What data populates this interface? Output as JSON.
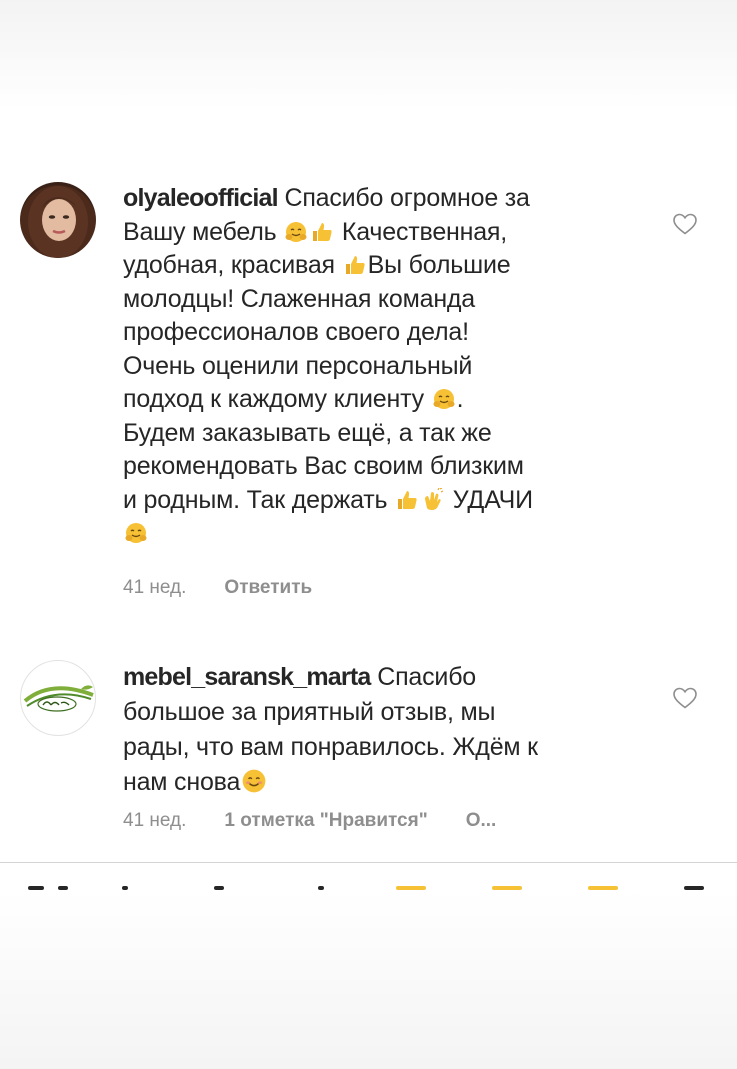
{
  "comments": [
    {
      "username": "olyaleoofficial",
      "lines": [
        {
          "text": " Спасибо огромное за"
        },
        {
          "text": "Вашу мебель "
        },
        {
          "text": " Качественная,"
        },
        {
          "text": "удобная, красивая "
        },
        {
          "text": "Вы большие"
        },
        {
          "text": "молодцы! Слаженная команда"
        },
        {
          "text": "профессионалов своего дела!"
        },
        {
          "text": "Очень оценили персональный"
        },
        {
          "text": "подход к каждому клиенту "
        },
        {
          "text": "."
        },
        {
          "text": "Будем заказывать ещё, а так же"
        },
        {
          "text": "рекомендовать Вас своим близким"
        },
        {
          "text": "и родным. Так держать "
        },
        {
          "text": " УДАЧИ"
        }
      ],
      "time": "41 нед.",
      "reply_label": "Ответить",
      "heart_icon": "heart-outline-icon"
    },
    {
      "username": "mebel_saransk_marta",
      "lines": [
        {
          "text": " Спасибо"
        },
        {
          "text": "большое за приятный отзыв, мы"
        },
        {
          "text": "рады, что вам понравилось. Ждём к"
        },
        {
          "text": "нам снова"
        }
      ],
      "time": "41 нед.",
      "likes_label": "1 отметка \"Нравится\"",
      "more_label": "О...",
      "heart_icon": "heart-outline-icon"
    }
  ],
  "colors": {
    "text": "#262626",
    "meta": "#8e8e8e",
    "divider": "#d4d4d4",
    "emoji_yellow": "#f7c136"
  }
}
